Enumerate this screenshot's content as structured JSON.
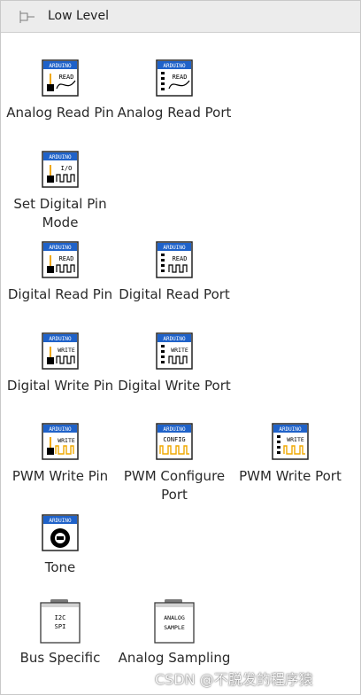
{
  "palette": {
    "title": "Low Level",
    "items": [
      {
        "label": "Analog Read Pin",
        "icon": "analog-read-pin-icon",
        "badge": "ARDUINO",
        "glyph": "READ"
      },
      {
        "label": "Analog Read Port",
        "icon": "analog-read-port-icon",
        "badge": "ARDUINO",
        "glyph": "READ"
      },
      {
        "label": "Set Digital Pin Mode",
        "icon": "set-digital-pin-mode-icon",
        "badge": "ARDUINO",
        "glyph": "I/O"
      },
      {
        "label": "Digital Read Pin",
        "icon": "digital-read-pin-icon",
        "badge": "ARDUINO",
        "glyph": "READ"
      },
      {
        "label": "Digital Read Port",
        "icon": "digital-read-port-icon",
        "badge": "ARDUINO",
        "glyph": "READ"
      },
      {
        "label": "Digital Write Pin",
        "icon": "digital-write-pin-icon",
        "badge": "ARDUINO",
        "glyph": "WRITE"
      },
      {
        "label": "Digital Write Port",
        "icon": "digital-write-port-icon",
        "badge": "ARDUINO",
        "glyph": "WRITE"
      },
      {
        "label": "PWM Write Pin",
        "icon": "pwm-write-pin-icon",
        "badge": "ARDUINO",
        "glyph": "WRITE"
      },
      {
        "label": "PWM Configure Port",
        "icon": "pwm-configure-port-icon",
        "badge": "ARDUINO",
        "glyph": "CONFIG"
      },
      {
        "label": "PWM Write Port",
        "icon": "pwm-write-port-icon",
        "badge": "ARDUINO",
        "glyph": "WRITE"
      },
      {
        "label": "Tone",
        "icon": "tone-icon",
        "badge": "ARDUINO",
        "glyph": ""
      },
      {
        "label": "Bus Specific",
        "icon": "bus-specific-folder-icon",
        "badge": "",
        "glyph": "I2C SPI"
      },
      {
        "label": "Analog Sampling",
        "icon": "analog-sampling-folder-icon",
        "badge": "",
        "glyph": "ANALOG SAMPLE"
      }
    ]
  },
  "watermark": "CSDN @不脱发的程序猿",
  "colors": {
    "badge": "#1f62c9",
    "panel_header": "#ececec",
    "wave": "#f0a800"
  }
}
